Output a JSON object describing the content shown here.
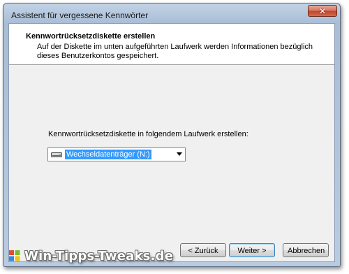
{
  "window": {
    "title": "Assistent für vergessene Kennwörter"
  },
  "header": {
    "title": "Kennwortrücksetzdiskette erstellen",
    "description": "Auf der Diskette im unten aufgeführten Laufwerk werden Informationen bezüglich dieses Benutzerkontos gespeichert."
  },
  "body": {
    "drive_label": "Kennwortrücksetzdiskette in folgendem Laufwerk erstellen:",
    "drive_select": {
      "selected": "Wechseldatenträger (N:)",
      "icon": "removable-drive-icon"
    }
  },
  "buttons": {
    "back": "< Zurück",
    "next": "Weiter >",
    "cancel": "Abbrechen"
  },
  "watermark": {
    "text": "Win-Tipps-Tweaks.de"
  },
  "colors": {
    "selection": "#3399ff",
    "close_button": "#c2452b"
  }
}
